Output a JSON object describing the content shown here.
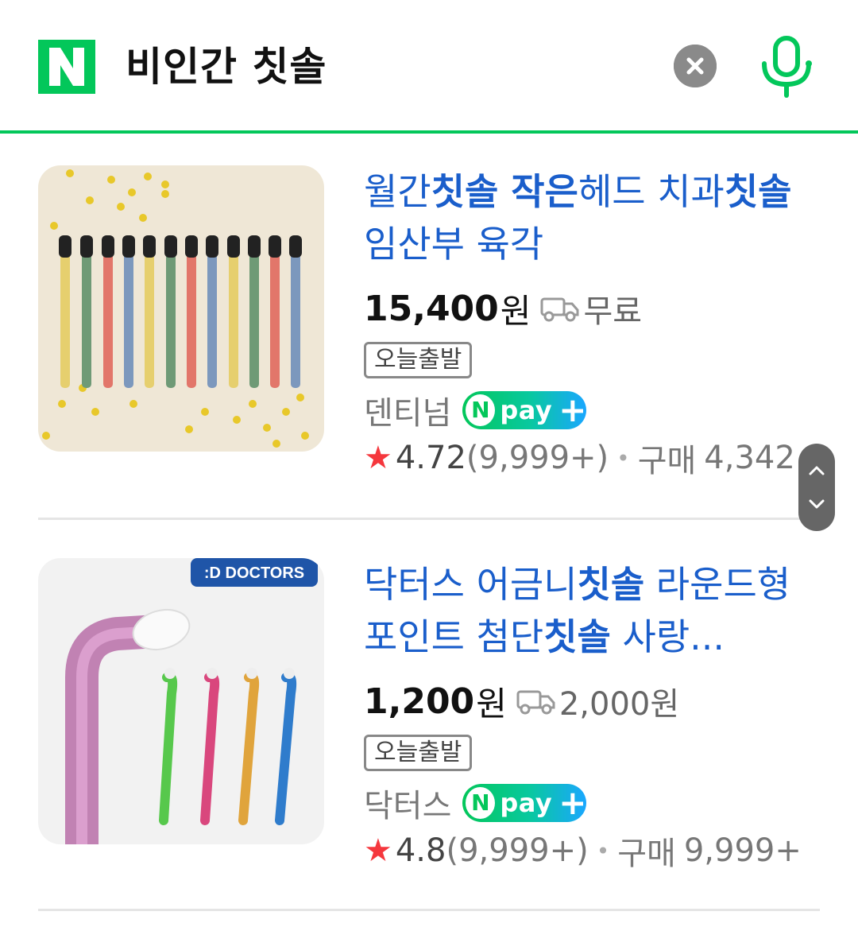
{
  "search": {
    "query": "비인간 칫솔",
    "clear_icon": "close-icon",
    "mic_icon": "microphone-icon"
  },
  "colors": {
    "brand_green": "#03c75a",
    "title_blue": "#1a5ecb",
    "star_red": "#f5373d"
  },
  "products": [
    {
      "title_parts": [
        {
          "text": "월간",
          "bold": false
        },
        {
          "text": "칫솔 작은",
          "bold": true
        },
        {
          "text": "헤드 치과",
          "bold": false
        },
        {
          "text": "칫솔",
          "bold": true
        },
        {
          "text": " 임산부 육각",
          "bold": false
        }
      ],
      "price": "15,400",
      "won": "원",
      "shipping": "무료",
      "badge": "오늘출발",
      "seller": "덴티넘",
      "npay": {
        "n": "N",
        "text": "pay",
        "plus": "+"
      },
      "rating": "4.72",
      "reviews": "(9,999+)",
      "purchase_label": "구매",
      "purchase_count": "4,342"
    },
    {
      "brand_badge": ":D DOCTORS",
      "title_parts": [
        {
          "text": "닥터스 어금니",
          "bold": false
        },
        {
          "text": "칫솔",
          "bold": true
        },
        {
          "text": " 라운드형 포인트 첨단",
          "bold": false
        },
        {
          "text": "칫솔",
          "bold": true
        },
        {
          "text": " 사랑...",
          "bold": false
        }
      ],
      "price": "1,200",
      "won": "원",
      "shipping": "2,000원",
      "badge": "오늘출발",
      "seller": "닥터스",
      "npay": {
        "n": "N",
        "text": "pay",
        "plus": "+"
      },
      "rating": "4.8",
      "reviews": "(9,999+)",
      "purchase_label": "구매",
      "purchase_count": "9,999+"
    }
  ],
  "scroll": {
    "up_icon": "chevron-up-icon",
    "down_icon": "chevron-down-icon"
  }
}
